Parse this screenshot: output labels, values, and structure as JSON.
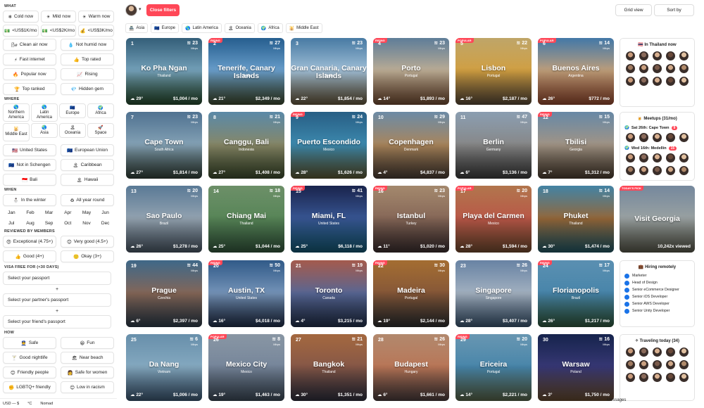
{
  "sidebar": {
    "sections": {
      "what": "WHAT",
      "where": "WHERE",
      "when": "WHEN",
      "reviewed": "REVIEWED BY MEMBERS",
      "visa": "VISA FREE FOR (<30 DAYS)",
      "how": "HOW"
    },
    "what_filters": [
      {
        "icon": "❄",
        "label": "Cold now"
      },
      {
        "icon": "☀",
        "label": "Mild now"
      },
      {
        "icon": "☀",
        "label": "Warm now"
      }
    ],
    "budget_filters": [
      {
        "icon": "💵",
        "label": "<US$1K/mo"
      },
      {
        "icon": "💵",
        "label": "<US$2K/mo"
      },
      {
        "icon": "💰",
        "label": "<US$3K/mo"
      }
    ],
    "pair_filters": [
      {
        "icon": "🌬",
        "label": "Clean air now"
      },
      {
        "icon": "💧",
        "label": "Not humid now"
      },
      {
        "icon": "⚡",
        "label": "Fast internet"
      },
      {
        "icon": "👍",
        "label": "Top rated"
      },
      {
        "icon": "🔥",
        "label": "Popular now"
      },
      {
        "icon": "📈",
        "label": "Rising"
      },
      {
        "icon": "🏆",
        "label": "Top ranked"
      },
      {
        "icon": "💎",
        "label": "Hidden gem"
      }
    ],
    "regions": [
      {
        "icon": "🌎",
        "label": "Northern America"
      },
      {
        "icon": "🌎",
        "label": "Latin America"
      },
      {
        "icon": "🇪🇺",
        "label": "Europe"
      },
      {
        "icon": "🌍",
        "label": "Africa"
      },
      {
        "icon": "🕌",
        "label": "Middle East"
      },
      {
        "icon": "🌏",
        "label": "Asia"
      },
      {
        "icon": "🏝",
        "label": "Oceania"
      },
      {
        "icon": "🚀",
        "label": "Space"
      }
    ],
    "where_pairs": [
      {
        "icon": "🇺🇸",
        "label": "United States"
      },
      {
        "icon": "🇪🇺",
        "label": "European Union"
      },
      {
        "icon": "🇪🇺",
        "label": "Not in Schengen"
      },
      {
        "icon": "🏝",
        "label": "Caribbean"
      },
      {
        "icon": "🇮🇩",
        "label": "Bali"
      },
      {
        "icon": "🏝",
        "label": "Hawaii"
      }
    ],
    "when_pairs": [
      {
        "icon": "⛄",
        "label": "In the winter"
      },
      {
        "icon": "♻",
        "label": "All year round"
      }
    ],
    "months": [
      "Jan",
      "Feb",
      "Mar",
      "Apr",
      "May",
      "Jun",
      "Jul",
      "Aug",
      "Sep",
      "Oct",
      "Nov",
      "Dec"
    ],
    "review_pairs": [
      {
        "icon": "😍",
        "label": "Exceptional (4.75+)"
      },
      {
        "icon": "😊",
        "label": "Very good (4.5+)"
      },
      {
        "icon": "👍",
        "label": "Good (4+)"
      },
      {
        "icon": "🙂",
        "label": "Okay (3+)"
      }
    ],
    "passports": [
      "Select your passport",
      "Select your partner's passport",
      "Select your friend's passport"
    ],
    "plus": "+",
    "how_pairs": [
      {
        "icon": "👮",
        "label": "Safe"
      },
      {
        "icon": "😀",
        "label": "Fun"
      },
      {
        "icon": "🍸",
        "label": "Good nightlife"
      },
      {
        "icon": "🏖",
        "label": "Near beach"
      },
      {
        "icon": "😊",
        "label": "Friendly people"
      },
      {
        "icon": "👩",
        "label": "Safe for women"
      },
      {
        "icon": "✊",
        "label": "LGBTQ+ friendly"
      },
      {
        "icon": "😊",
        "label": "Low in racism"
      }
    ],
    "bottom": [
      "USD — $",
      "°C",
      "Nomad"
    ]
  },
  "topbar": {
    "close_filters": "Close filters",
    "grid_view": "Grid view",
    "sort_by": "Sort by"
  },
  "tabs": [
    {
      "icon": "🏯",
      "label": "Asia"
    },
    {
      "icon": "🇪🇺",
      "label": "Europe"
    },
    {
      "icon": "🌎",
      "label": "Latin America"
    },
    {
      "icon": "🏝",
      "label": "Oceania"
    },
    {
      "icon": "🌍",
      "label": "Africa"
    },
    {
      "icon": "🕌",
      "label": "Middle East"
    }
  ],
  "cities": [
    {
      "rank": "1",
      "wifi": "23",
      "city": "Ko Pha Ngan",
      "country": "Thailand",
      "temp": "29°",
      "cost": "$1,004 / mo",
      "badge": "",
      "bg": "#3d6f8e,#7aa9c2,#2f5a37"
    },
    {
      "rank": "2",
      "wifi": "27",
      "city": "Tenerife, Canary Islands",
      "country": "Spain",
      "temp": "21°",
      "cost": "$2,349 / mo",
      "badge": "RISING",
      "bg": "#2d6fa8,#6fa6d4,#4b5a3a"
    },
    {
      "rank": "3",
      "wifi": "23",
      "city": "Gran Canaria, Canary Islands",
      "country": "Spain",
      "temp": "22°",
      "cost": "$1,854 / mo",
      "badge": "",
      "bg": "#5590c0,#a9c8e0,#7b6a4a"
    },
    {
      "rank": "4",
      "wifi": "23",
      "city": "Porto",
      "country": "Portugal",
      "temp": "14°",
      "cost": "$1,893 / mo",
      "badge": "RISING",
      "bg": "#6f93b3,#c5b49a,#8a5c3e"
    },
    {
      "rank": "5",
      "wifi": "22",
      "city": "Lisbon",
      "country": "Portugal",
      "temp": "16°",
      "cost": "$2,187 / mo",
      "badge": "POPULAR",
      "bg": "#e0c27a,#d9a544,#6e5a43"
    },
    {
      "rank": "6",
      "wifi": "14",
      "city": "Buenos Aires",
      "country": "Argentina",
      "temp": "26°",
      "cost": "$772 / mo",
      "badge": "POPULAR",
      "bg": "#4f8dc4,#c9a57e,#b35a3a"
    },
    {
      "rank": "7",
      "wifi": "23",
      "city": "Cape Town",
      "country": "South Africa",
      "temp": "27°",
      "cost": "$1,814 / mo",
      "badge": "",
      "bg": "#5e86aa,#8aa9bd,#3e4f45"
    },
    {
      "rank": "8",
      "wifi": "21",
      "city": "Canggu, Bali",
      "country": "Indonesia",
      "temp": "27°",
      "cost": "$1,408 / mo",
      "badge": "",
      "bg": "#6aa1c4,#8c8c6a,#4a5b37"
    },
    {
      "rank": "9",
      "wifi": "24",
      "city": "Puerto Escondido",
      "country": "Mexico",
      "temp": "28°",
      "cost": "$1,626 / mo",
      "badge": "RISING",
      "bg": "#2f6f9c,#3f8fb5,#6e6a3f"
    },
    {
      "rank": "10",
      "wifi": "29",
      "city": "Copenhagen",
      "country": "Denmark",
      "temp": "4°",
      "cost": "$4,837 / mo",
      "badge": "",
      "bg": "#7fa3c2,#b08a5e,#5a4a3f"
    },
    {
      "rank": "11",
      "wifi": "47",
      "city": "Berlin",
      "country": "Germany",
      "temp": "6°",
      "cost": "$3,136 / mo",
      "badge": "",
      "bg": "#a3b9cf,#8c8c8c,#4a4a4a"
    },
    {
      "rank": "12",
      "wifi": "15",
      "city": "Tbilisi",
      "country": "Georgia",
      "temp": "7°",
      "cost": "$1,312 / mo",
      "badge": "RISING",
      "bg": "#7aa0c2,#a89a8a,#5a4a3a"
    },
    {
      "rank": "13",
      "wifi": "20",
      "city": "Sao Paulo",
      "country": "Brazil",
      "temp": "26°",
      "cost": "$1,278 / mo",
      "badge": "",
      "bg": "#6a8fb0,#9aaab8,#5a6a7a"
    },
    {
      "rank": "14",
      "wifi": "18",
      "city": "Chiang Mai",
      "country": "Thailand",
      "temp": "25°",
      "cost": "$1,044 / mo",
      "badge": "",
      "bg": "#7fa87a,#5a8a5a,#3f6a4a"
    },
    {
      "rank": "15",
      "wifi": "41",
      "city": "Miami, FL",
      "country": "United States",
      "temp": "25°",
      "cost": "$6,118 / mo",
      "badge": "RISING",
      "bg": "#1e2a5a,#3a5a9a,#1a6a8a"
    },
    {
      "rank": "16",
      "wifi": "23",
      "city": "Istanbul",
      "country": "Turkey",
      "temp": "11°",
      "cost": "$1,020 / mo",
      "badge": "RISING",
      "bg": "#c0a080,#8a6a5a,#4a3a3a"
    },
    {
      "rank": "17",
      "wifi": "20",
      "city": "Playa del Carmen",
      "country": "Mexico",
      "temp": "28°",
      "cost": "$1,594 / mo",
      "badge": "POPULAR",
      "bg": "#d08a5a,#c05a4a,#8a5a3a"
    },
    {
      "rank": "18",
      "wifi": "14",
      "city": "Phuket",
      "country": "Thailand",
      "temp": "30°",
      "cost": "$1,474 / mo",
      "badge": "",
      "bg": "#4f9ac0,#9a6a3a,#2a6a7a"
    },
    {
      "rank": "19",
      "wifi": "44",
      "city": "Prague",
      "country": "Czechia",
      "temp": "6°",
      "cost": "$2,397 / mo",
      "badge": "",
      "bg": "#4a7aa0,#8a6a5a,#3a4a5a"
    },
    {
      "rank": "20",
      "wifi": "50",
      "city": "Austin, TX",
      "country": "United States",
      "temp": "16°",
      "cost": "$4,018 / mo",
      "badge": "RISING",
      "bg": "#3a6aa0,#7a9ac0,#2a3a5a"
    },
    {
      "rank": "21",
      "wifi": "19",
      "city": "Toronto",
      "country": "Canada",
      "temp": "4°",
      "cost": "$3,215 / mo",
      "badge": "",
      "bg": "#c06a5a,#5a6a9a,#2a3a5a"
    },
    {
      "rank": "22",
      "wifi": "30",
      "city": "Madeira",
      "country": "Portugal",
      "temp": "19°",
      "cost": "$2,144 / mo",
      "badge": "RISING",
      "bg": "#c0803a,#8a5a3a,#3a3a3a"
    },
    {
      "rank": "23",
      "wifi": "26",
      "city": "Singapore",
      "country": "Singapore",
      "temp": "28°",
      "cost": "$3,407 / mo",
      "badge": "",
      "bg": "#7a9ac0,#aab8c8,#4a6a8a"
    },
    {
      "rank": "24",
      "wifi": "17",
      "city": "Florianopolis",
      "country": "Brazil",
      "temp": "26°",
      "cost": "$1,217 / mo",
      "badge": "RISING",
      "bg": "#6aa8d0,#4a8ab0,#3a6a4a"
    },
    {
      "rank": "25",
      "wifi": "6",
      "city": "Da Nang",
      "country": "Vietnam",
      "temp": "22°",
      "cost": "$1,006 / mo",
      "badge": "",
      "bg": "#7aa8c8,#8ab0c8,#4a6a8a"
    },
    {
      "rank": "26",
      "wifi": "8",
      "city": "Mexico City",
      "country": "Mexico",
      "temp": "19°",
      "cost": "$1,463 / mo",
      "badge": "POPULAR",
      "bg": "#a0b0c0,#7a8aa0,#4a5a6a"
    },
    {
      "rank": "27",
      "wifi": "21",
      "city": "Bangkok",
      "country": "Thailand",
      "temp": "30°",
      "cost": "$1,351 / mo",
      "badge": "",
      "bg": "#c07a4a,#8a5a4a,#3a3a4a"
    },
    {
      "rank": "28",
      "wifi": "26",
      "city": "Budapest",
      "country": "Hungary",
      "temp": "6°",
      "cost": "$1,661 / mo",
      "badge": "",
      "bg": "#d0a080,#c07a5a,#5a4a4a"
    },
    {
      "rank": "29",
      "wifi": "20",
      "city": "Ericeira",
      "country": "Portugal",
      "temp": "14°",
      "cost": "$2,221 / mo",
      "badge": "RISING",
      "bg": "#7ab0d0,#4a8ab0,#6a7a5a"
    },
    {
      "rank": "30",
      "wifi": "16",
      "city": "Warsaw",
      "country": "Poland",
      "temp": "3°",
      "cost": "$1,750 / mo",
      "badge": "",
      "bg": "#1a2a5a,#3a3a7a,#7a5a3a"
    },
    {
      "rank": "",
      "wifi": "",
      "city": "Visit Georgia",
      "country": "",
      "temp": "",
      "cost": "10,242x viewed",
      "badge": "TODAY'S PICK",
      "bg": "#8aa0b8,#a0a8a8,#6a6a5a"
    }
  ],
  "panels": {
    "thailand": {
      "title": "In Thailand now"
    },
    "meetups": {
      "title": "Meetups (31/mo)",
      "items": [
        {
          "label": "Sat 26th: Cape Town",
          "count": "9"
        },
        {
          "label": "Wed 16th: Medellín",
          "count": "15"
        }
      ]
    },
    "hiring": {
      "title": "Hiring remotely",
      "jobs": [
        "Marketer",
        "Head of Design",
        "Senior eCommerce Designer",
        "Senior iOS Developer",
        "Senior AWS Developer",
        "Senior Unity Developer"
      ]
    },
    "traveling": {
      "title": "Traveling today (34)"
    }
  },
  "footer": {
    "messages": "Messages"
  }
}
